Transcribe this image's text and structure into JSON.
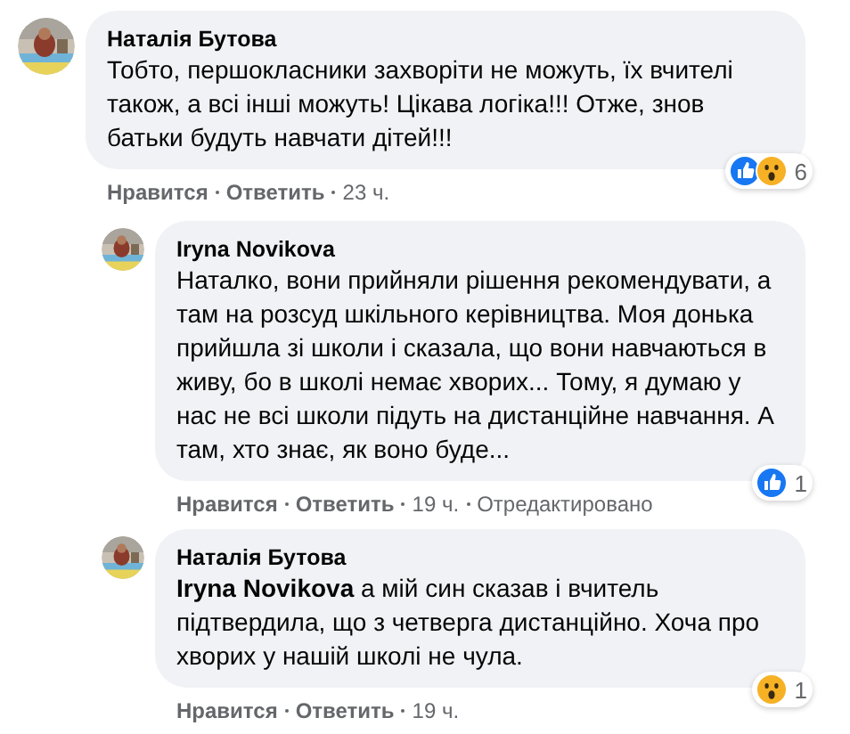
{
  "comments": [
    {
      "author": "Наталія Бутова",
      "text": "Тобто, першокласники захворіти не можуть, їх вчителі також, а всі інші можуть! Цікава логіка!!! Отже, знов батьки будуть навчати дітей!!!",
      "reactions": [
        {
          "kind": "like"
        },
        {
          "kind": "wow"
        }
      ],
      "reaction_count": "6",
      "like_label": "Нравится",
      "reply_label": "Ответить",
      "time": "23 ч.",
      "replies": [
        {
          "author": "Iryna Novikova",
          "text": "Наталко, вони прийняли рішення рекомендувати, а там на розсуд шкільного керівництва. Моя донька прийшла зі школи і сказала, що вони навчаються в живу, бо в школі немає хворих... Тому, я думаю у нас не всі школи підуть на дистанційне навчання. А там, хто знає, як воно буде...",
          "reactions": [
            {
              "kind": "like"
            }
          ],
          "reaction_count": "1",
          "like_label": "Нравится",
          "reply_label": "Ответить",
          "time": "19 ч.",
          "edited": "Отредактировано"
        },
        {
          "author": "Наталія Бутова",
          "text": "**Iryna Novikova** а мій син сказав і вчитель підтвердила, що з четверга дистанційно. Хоча про хворих у нашій школі не чула.",
          "reactions": [
            {
              "kind": "wow"
            }
          ],
          "reaction_count": "1",
          "like_label": "Нравится",
          "reply_label": "Ответить",
          "time": "19 ч."
        }
      ]
    }
  ]
}
